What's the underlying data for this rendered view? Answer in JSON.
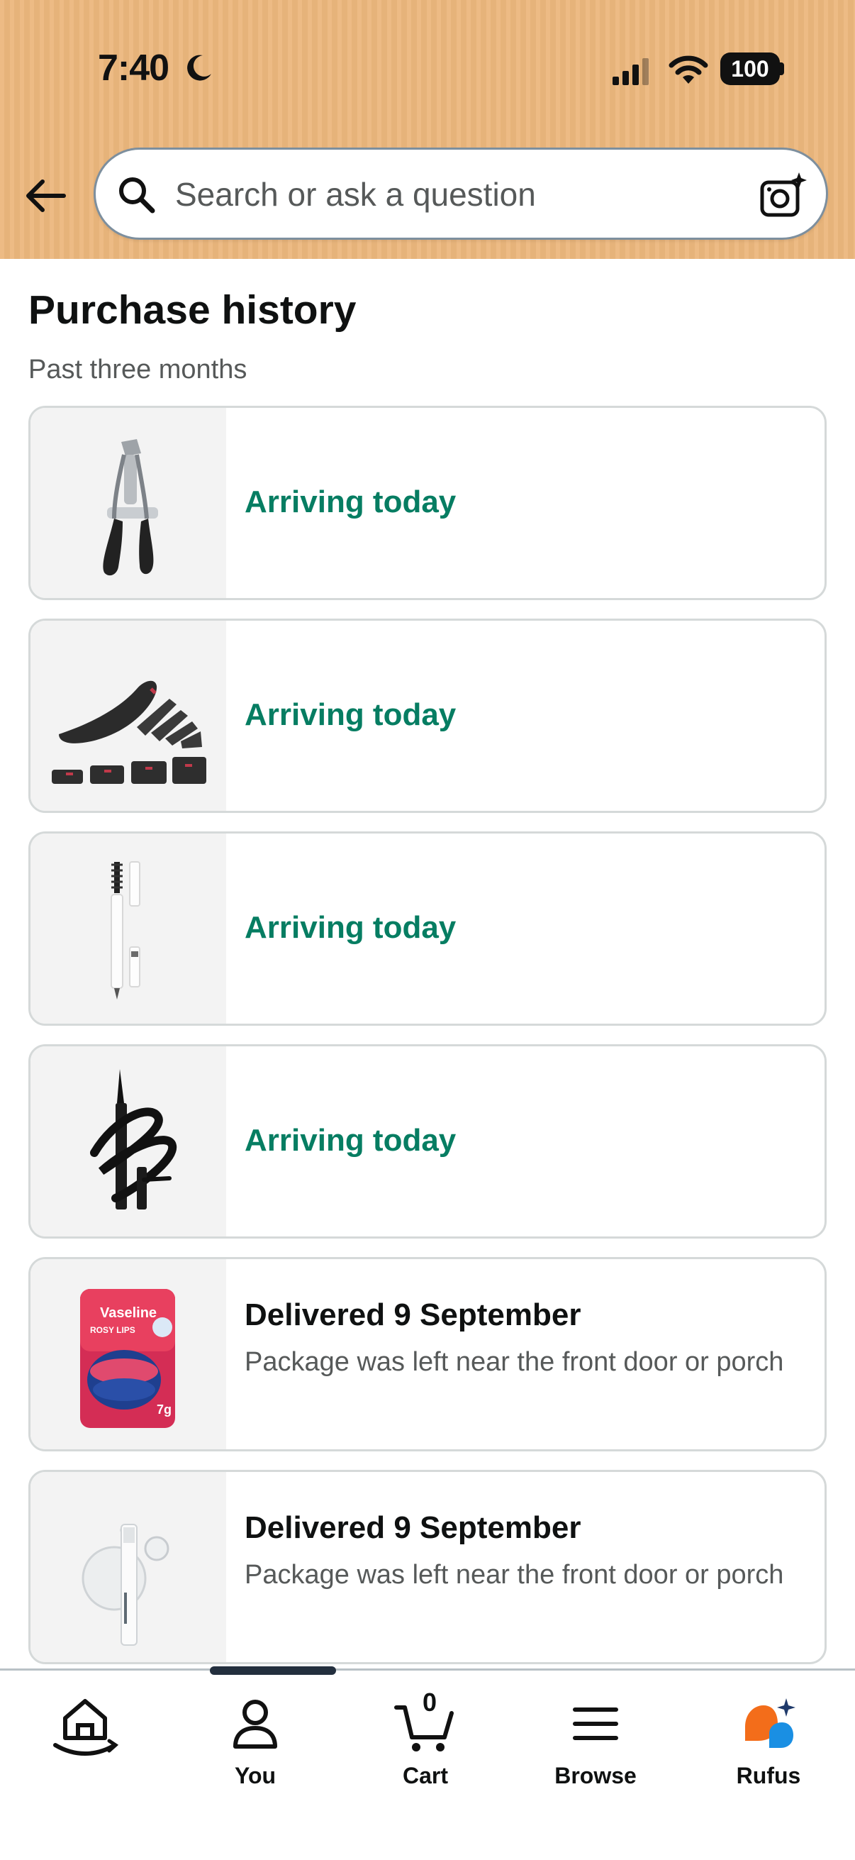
{
  "status_bar": {
    "time": "7:40",
    "battery": "100"
  },
  "search": {
    "placeholder": "Search or ask a question"
  },
  "page": {
    "title": "Purchase history",
    "subtitle": "Past three months"
  },
  "orders": [
    {
      "status": "Arriving today",
      "detail": "",
      "product_icon": "eyelash-curler"
    },
    {
      "status": "Arriving today",
      "detail": "",
      "product_icon": "shoe-height-insoles"
    },
    {
      "status": "Arriving today",
      "detail": "",
      "product_icon": "brow-pencil"
    },
    {
      "status": "Arriving today",
      "detail": "",
      "product_icon": "liquid-eyeliner"
    },
    {
      "status": "Delivered 9 September",
      "detail": "Package was left near the front door or porch",
      "product_icon": "vaseline-rosy-lips"
    },
    {
      "status": "Delivered 9 September",
      "detail": "Package was left near the front door or porch",
      "product_icon": "clear-brow-gel"
    }
  ],
  "product_label": {
    "vaseline_brand": "Vaseline",
    "vaseline_name": "ROSY LIPS",
    "vaseline_weight": "7g"
  },
  "bottom_nav": {
    "home": "",
    "you": "You",
    "cart": "Cart",
    "cart_count": "0",
    "browse": "Browse",
    "rufus": "Rufus"
  },
  "colors": {
    "header_bg": "#ecb77d",
    "arriving_green": "#067d62",
    "rufus_orange": "#f36d1a",
    "rufus_blue": "#1a8fe3"
  }
}
